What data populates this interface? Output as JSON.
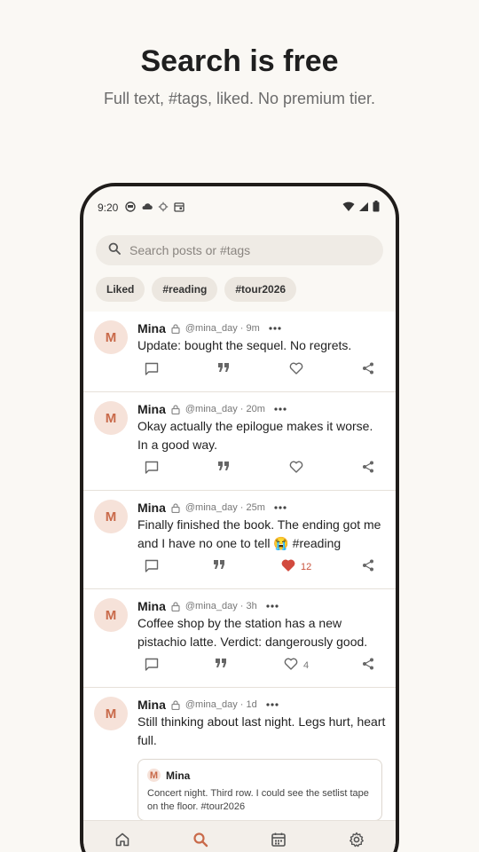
{
  "headline": "Search is free",
  "subhead": "Full text, #tags, liked. No premium tier.",
  "status": {
    "time": "9:20",
    "left_icons": [
      "vpn-icon",
      "cloud-icon",
      "settings-icon",
      "calendar-icon"
    ],
    "right_icons": [
      "wifi-icon",
      "signal-icon",
      "battery-icon"
    ]
  },
  "search": {
    "placeholder": "Search posts or #tags"
  },
  "chips": [
    "Liked",
    "#reading",
    "#tour2026"
  ],
  "posts": [
    {
      "avatar": "M",
      "name": "Mina",
      "handle": "@mina_day",
      "time": "9m",
      "meta": "@mina_day · 9m",
      "text": "Update: bought the sequel. No regrets.",
      "liked": false,
      "likes": ""
    },
    {
      "avatar": "M",
      "name": "Mina",
      "handle": "@mina_day",
      "time": "20m",
      "meta": "@mina_day · 20m",
      "text": "Okay actually the epilogue makes it worse. In a good way.",
      "liked": false,
      "likes": ""
    },
    {
      "avatar": "M",
      "name": "Mina",
      "handle": "@mina_day",
      "time": "25m",
      "meta": "@mina_day · 25m",
      "text": "Finally finished the book. The ending got me and I have no one to tell 😭 #reading",
      "liked": true,
      "likes": "12"
    },
    {
      "avatar": "M",
      "name": "Mina",
      "handle": "@mina_day",
      "time": "3h",
      "meta": "@mina_day · 3h",
      "text": "Coffee shop by the station has a new pistachio latte. Verdict: dangerously good.",
      "liked": false,
      "likes": "4"
    },
    {
      "avatar": "M",
      "name": "Mina",
      "handle": "@mina_day",
      "time": "1d",
      "meta": "@mina_day · 1d",
      "text": "Still thinking about last night. Legs hurt, heart full.",
      "quote": {
        "avatar": "M",
        "name": "Mina",
        "text": "Concert night. Third row. I could see the setlist tape on the floor. #tour2026"
      }
    }
  ],
  "nav": [
    "home-icon",
    "search-icon",
    "calendar-icon",
    "settings-icon"
  ],
  "colors": {
    "accent": "#c96a4a",
    "like": "#d24a3e",
    "background": "#faf8f4"
  }
}
